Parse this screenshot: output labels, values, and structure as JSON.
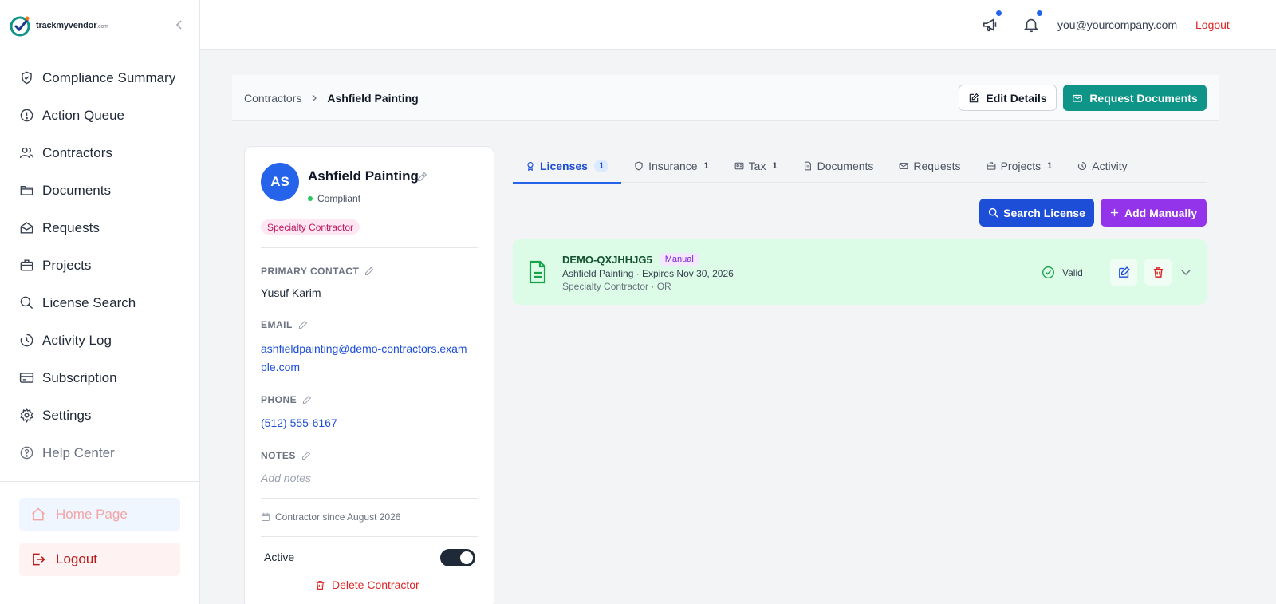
{
  "brand": {
    "name": "trackmyvendor",
    "tld": ".com",
    "accent": "#0f9488"
  },
  "sidebar": {
    "items": [
      {
        "label": "Compliance Summary",
        "icon": "shield-check-icon"
      },
      {
        "label": "Action Queue",
        "icon": "alert-circle-icon"
      },
      {
        "label": "Contractors",
        "icon": "users-icon"
      },
      {
        "label": "Documents",
        "icon": "folder-icon"
      },
      {
        "label": "Requests",
        "icon": "mail-open-icon"
      },
      {
        "label": "Projects",
        "icon": "briefcase-icon"
      },
      {
        "label": "License Search",
        "icon": "search-icon"
      },
      {
        "label": "Activity Log",
        "icon": "clock-icon"
      },
      {
        "label": "Subscription",
        "icon": "credit-card-icon"
      },
      {
        "label": "Settings",
        "icon": "gear-icon"
      },
      {
        "label": "Help Center",
        "icon": "help-circle-icon"
      }
    ],
    "home_label": "Home Page",
    "logout_label": "Logout"
  },
  "topbar": {
    "user_email": "you@yourcompany.com",
    "logout_label": "Logout"
  },
  "breadcrumb": {
    "parent": "Contractors",
    "current": "Ashfield Painting"
  },
  "header": {
    "edit_label": "Edit Details",
    "request_label": "Request Documents"
  },
  "contractor": {
    "initials": "AS",
    "name": "Ashfield Painting",
    "status": "Compliant",
    "type_badge": "Specialty Contractor",
    "primary_contact_label": "PRIMARY CONTACT",
    "primary_contact": "Yusuf Karim",
    "email_label": "EMAIL",
    "email": "ashfieldpainting@demo-contractors.example.com",
    "phone_label": "PHONE",
    "phone": "(512) 555-6167",
    "notes_label": "NOTES",
    "notes_placeholder": "Add notes",
    "since": "Contractor since August 2026",
    "active_label": "Active",
    "active": true,
    "delete_label": "Delete Contractor"
  },
  "tabs": [
    {
      "label": "Licenses",
      "count": "1",
      "icon": "award-icon",
      "active": true
    },
    {
      "label": "Insurance",
      "count": "1",
      "icon": "shield-icon"
    },
    {
      "label": "Tax",
      "count": "1",
      "icon": "id-card-icon"
    },
    {
      "label": "Documents",
      "count": "",
      "icon": "file-icon"
    },
    {
      "label": "Requests",
      "count": "",
      "icon": "mail-icon"
    },
    {
      "label": "Projects",
      "count": "1",
      "icon": "briefcase-icon"
    },
    {
      "label": "Activity",
      "count": "",
      "icon": "clock-icon"
    }
  ],
  "actions": {
    "search_label": "Search License",
    "add_label": "Add Manually"
  },
  "license": {
    "id": "DEMO-QXJHHJG5",
    "badge": "Manual",
    "line1": "Ashfield Painting · Expires Nov 30, 2026",
    "line2": "Specialty Contractor · OR",
    "status": "Valid"
  }
}
